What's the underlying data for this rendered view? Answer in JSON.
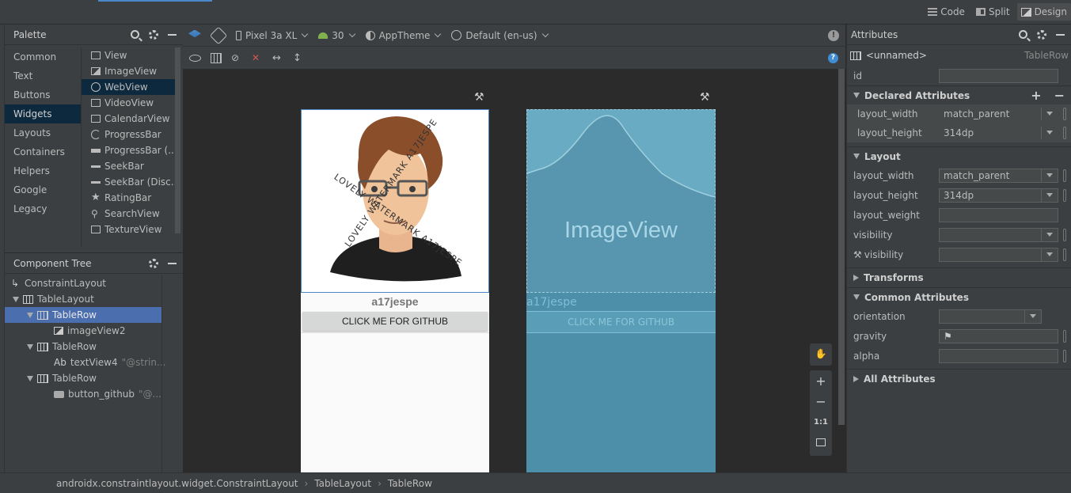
{
  "top_tabs": {
    "code": "Code",
    "split": "Split",
    "design": "Design"
  },
  "palette": {
    "title": "Palette",
    "categories": [
      "Common",
      "Text",
      "Buttons",
      "Widgets",
      "Layouts",
      "Containers",
      "Helpers",
      "Google",
      "Legacy"
    ],
    "selected_category": "Widgets",
    "widgets": [
      "View",
      "ImageView",
      "WebView",
      "VideoView",
      "CalendarView",
      "ProgressBar",
      "ProgressBar (...",
      "SeekBar",
      "SeekBar (Disc...",
      "RatingBar",
      "SearchView",
      "TextureView"
    ],
    "selected_widget": "WebView"
  },
  "component_tree": {
    "title": "Component Tree",
    "nodes": [
      {
        "label": "ConstraintLayout",
        "hint": ""
      },
      {
        "label": "TableLayout",
        "hint": ""
      },
      {
        "label": "TableRow",
        "hint": ""
      },
      {
        "label": "imageView2",
        "hint": ""
      },
      {
        "label": "TableRow",
        "hint": ""
      },
      {
        "label": "textView4",
        "hint": "\"@strin..."
      },
      {
        "label": "TableRow",
        "hint": ""
      },
      {
        "label": "button_github",
        "hint": "\"@..."
      }
    ],
    "textview_prefix": "Ab"
  },
  "design_toolbar": {
    "device": "Pixel 3a XL",
    "api": "30",
    "theme": "AppTheme",
    "locale": "Default (en-us)"
  },
  "design_preview": {
    "watermark_lines": [
      "LOVELY WATERMARK A17JESPE",
      "LOVELY WATERMARK A17JESPE"
    ],
    "username": "a17jespe",
    "button": "CLICK ME FOR GITHUB"
  },
  "blueprint_preview": {
    "image_label": "ImageView",
    "username": "a17jespe",
    "button": "CLICK ME FOR GITHUB"
  },
  "zoom_controls": {
    "one_to_one": "1:1"
  },
  "breadcrumb": [
    "androidx.constraintlayout.widget.ConstraintLayout",
    "TableLayout",
    "TableRow"
  ],
  "attributes": {
    "title": "Attributes",
    "component_name": "<unnamed>",
    "component_type": "TableRow",
    "id_label": "id",
    "id_value": "",
    "sections": {
      "declared": "Declared Attributes",
      "layout": "Layout",
      "transforms": "Transforms",
      "common": "Common Attributes",
      "all": "All Attributes"
    },
    "declared": [
      {
        "name": "layout_width",
        "value": "match_parent"
      },
      {
        "name": "layout_height",
        "value": "314dp"
      }
    ],
    "layout": [
      {
        "name": "layout_width",
        "value": "match_parent"
      },
      {
        "name": "layout_height",
        "value": "314dp"
      },
      {
        "name": "layout_weight",
        "value": ""
      },
      {
        "name": "visibility",
        "value": ""
      },
      {
        "name": "visibility",
        "value": ""
      }
    ],
    "common": [
      {
        "name": "orientation",
        "value": ""
      },
      {
        "name": "gravity",
        "value": ""
      },
      {
        "name": "alpha",
        "value": ""
      }
    ]
  }
}
